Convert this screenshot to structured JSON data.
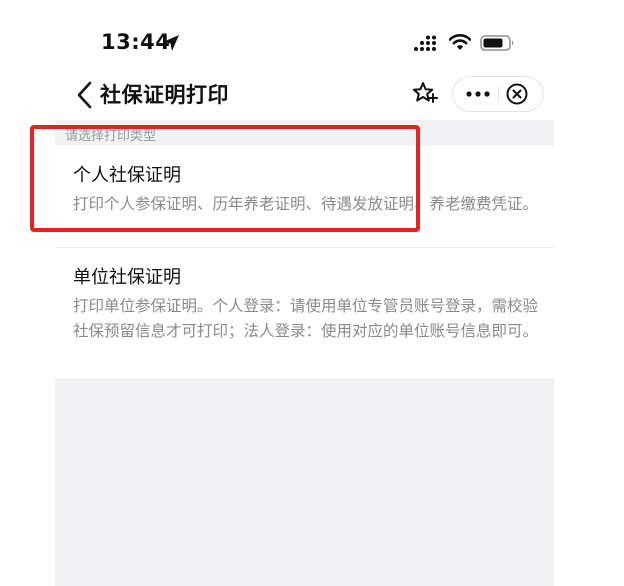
{
  "status_bar": {
    "time": "13:44",
    "icons": [
      "location-arrow-icon",
      "signal-icon",
      "wifi-icon",
      "battery-icon"
    ]
  },
  "nav": {
    "title": "社保证明打印",
    "icons": [
      "back-chevron-icon",
      "star-icon",
      "more-dots-icon",
      "close-circle-icon"
    ]
  },
  "section_label": "请选择打印类型",
  "options": [
    {
      "title": "个人社保证明",
      "description": "打印个人参保证明、历年养老证明、待遇发放证明、养老缴费凭证。"
    },
    {
      "title": "单位社保证明",
      "description": "打印单位参保证明。个人登录：请使用单位专管员账号登录，需校验社保预留信息才可打印；法人登录：使用对应的单位账号信息即可。"
    }
  ],
  "colors": {
    "background": "#f2f2f4",
    "highlight_box": "#e8231d",
    "description_text": "#8a8a8a"
  }
}
